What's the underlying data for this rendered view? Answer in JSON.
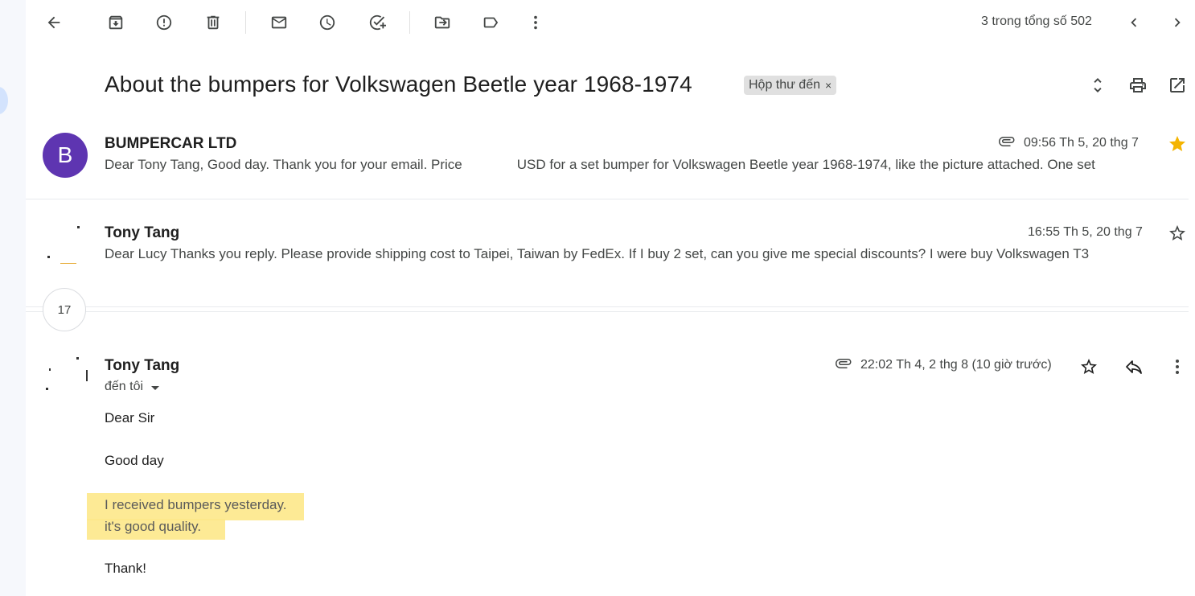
{
  "toolbar": {
    "pager_text": "3 trong tổng số 502",
    "icons": [
      "arrow-left-icon",
      "archive-icon",
      "report-spam-icon",
      "trash-icon",
      "mark-unread-icon",
      "snooze-icon",
      "add-task-icon",
      "move-to-icon",
      "label-icon",
      "more-vert-icon",
      "chevron-left-icon",
      "chevron-right-icon"
    ]
  },
  "thread": {
    "subject": "About the bumpers for Volkswagen Beetle year 1968-1974",
    "label": "Hộp thư đến",
    "label_remove": "×"
  },
  "messages": [
    {
      "avatar_letter": "B",
      "sender": "BUMPERCAR LTD",
      "date": "09:56 Th 5, 20 thg 7",
      "snippet_a": "Dear Tony Tang, Good day. Thank you for your email. Price",
      "snippet_b": "USD for a set bumper for Volkswagen Beetle year 1968-1974, like the picture attached. One set",
      "starred": true,
      "has_attachment": true
    },
    {
      "sender": "Tony Tang",
      "date": "16:55 Th 5, 20 thg 7",
      "snippet": "Dear Lucy Thanks you reply. Please provide shipping cost to Taipei, Taiwan by FedEx. If I buy 2 set, can you give me special discounts? I were buy Volkswagen T3",
      "starred": false
    }
  ],
  "collapsed_count": "17",
  "open_message": {
    "sender": "Tony Tang",
    "recipient": "đến tôi",
    "date": "22:02 Th 4, 2 thg 8 (10 giờ trước)",
    "has_attachment": true,
    "lines": {
      "greeting": "Dear Sir",
      "good_day": "Good day",
      "received": "I received bumpers yesterday.",
      "quality": "it's  good quality.",
      "thanks": "Thank!"
    },
    "highlight_color": "#fde88a"
  },
  "colors": {
    "avatar_b": "#5e35b1",
    "star_filled": "#f4b400",
    "label_chip_bg": "#e0e0e0"
  }
}
